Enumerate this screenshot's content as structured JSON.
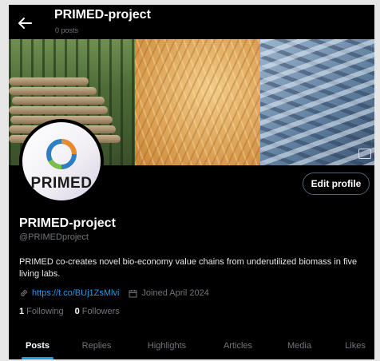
{
  "header": {
    "title": "PRIMED-project",
    "post_count": "0 posts"
  },
  "avatar": {
    "logo_text": "PRIMED"
  },
  "buttons": {
    "edit_profile": "Edit profile"
  },
  "profile": {
    "name": "PRIMED-project",
    "handle": "@PRIMEDproject",
    "bio": "PRIMED co-creates novel bio-economy value chains from underutilized biomass in five living labs.",
    "link": "https://t.co/BUj1ZsMlvi",
    "joined": "Joined April 2024",
    "following_count": "1",
    "following_label": "Following",
    "followers_count": "0",
    "followers_label": "Followers"
  },
  "tabs": [
    {
      "label": "Posts"
    },
    {
      "label": "Replies"
    },
    {
      "label": "Highlights"
    },
    {
      "label": "Articles"
    },
    {
      "label": "Media"
    },
    {
      "label": "Likes"
    }
  ],
  "colors": {
    "background": "#000000",
    "accent": "#1d9bf0",
    "muted_text": "#71767b"
  },
  "icons": [
    "back-arrow-icon",
    "link-icon",
    "calendar-icon",
    "photo-icon"
  ]
}
